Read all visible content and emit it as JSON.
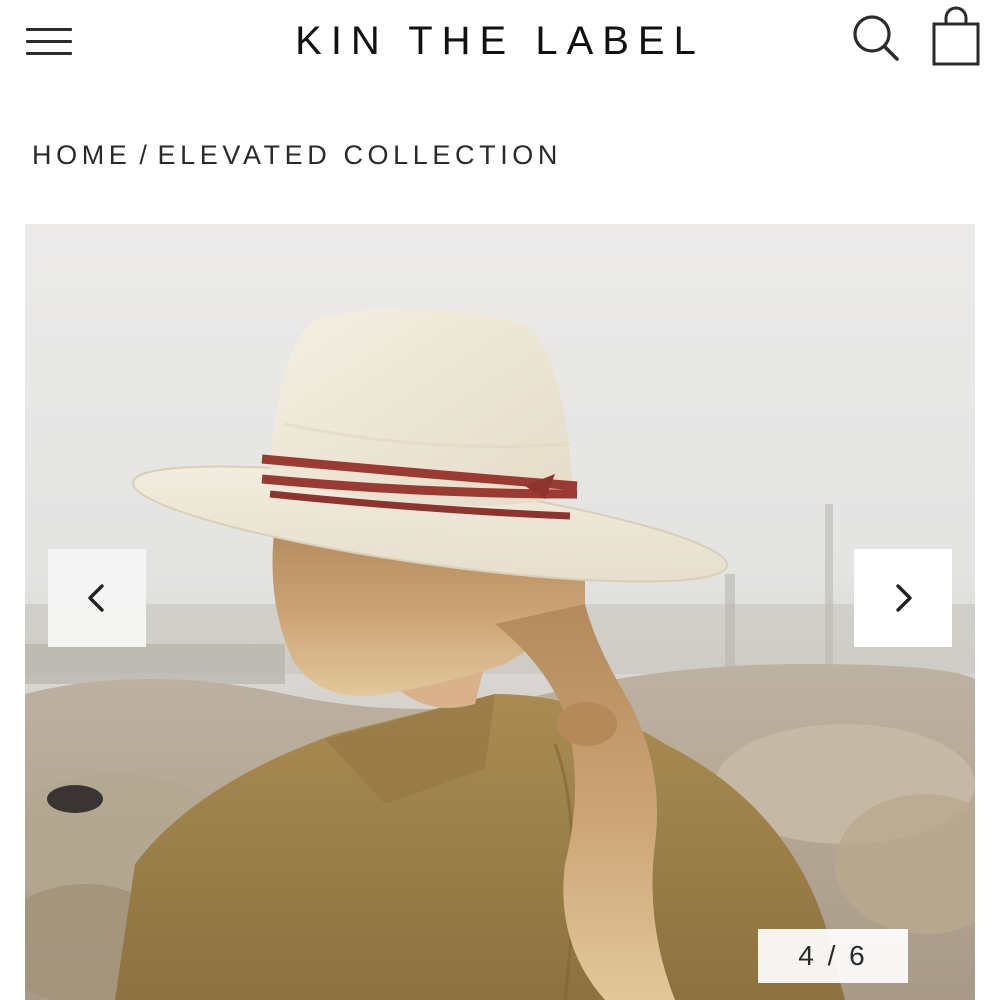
{
  "header": {
    "brand": "KIN THE LABEL",
    "menu_icon": "hamburger-menu-icon",
    "search_icon": "search-icon",
    "cart_icon": "shopping-bag-icon"
  },
  "breadcrumb": {
    "home": "HOME",
    "separator": "/",
    "current": "ELEVATED COLLECTION"
  },
  "gallery": {
    "image_alt": "",
    "prev_icon": "chevron-left-icon",
    "next_icon": "chevron-right-icon",
    "counter": "4 / 6",
    "current_index": 4,
    "total": 6
  },
  "colors": {
    "text": "#1a1a1a",
    "hat_straw": "#efe8d8",
    "hat_band": "#9b3a33",
    "jacket": "#a0844c",
    "hair": "#c9a070"
  }
}
